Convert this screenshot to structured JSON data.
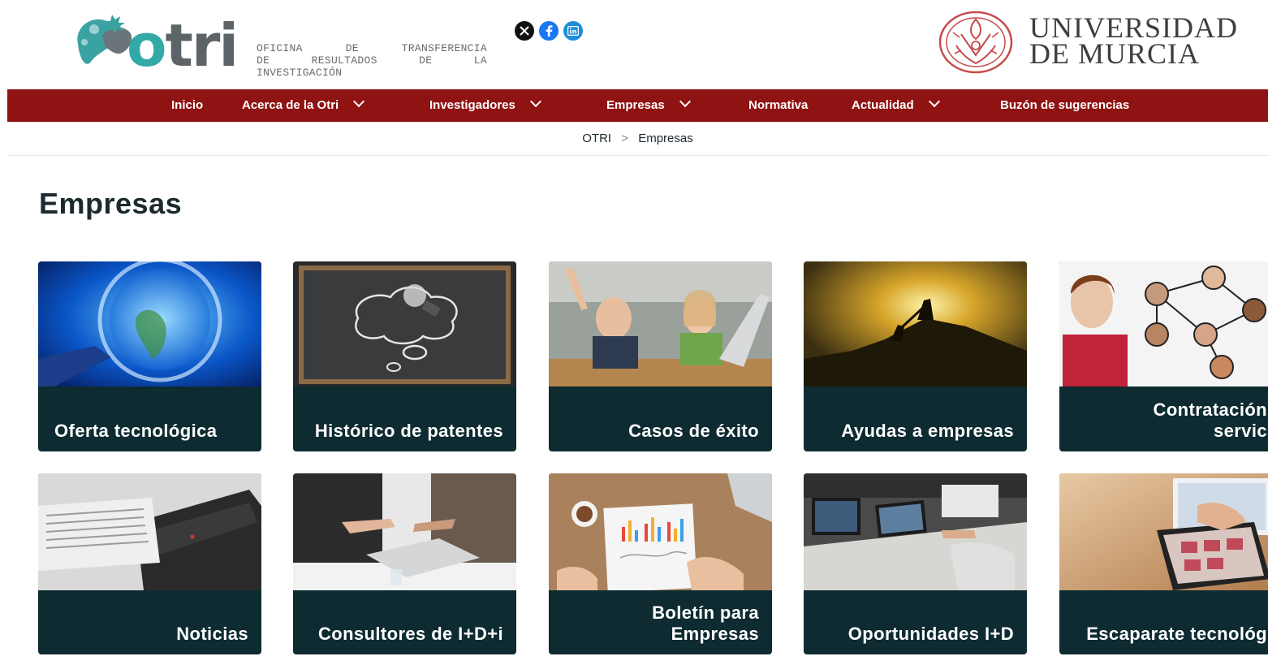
{
  "header": {
    "logo": {
      "word_o": "o",
      "word_rest": "tri",
      "sub_line1": [
        "OFICINA",
        "DE",
        "TRANSFERENCIA"
      ],
      "sub_line2": [
        "DE",
        "RESULTADOS",
        "DE",
        "LA"
      ],
      "sub_line3": "INVESTIGACIÓN"
    },
    "social": {
      "x_icon": "x-icon",
      "facebook_icon": "facebook-icon",
      "linkedin_icon": "linkedin-icon"
    },
    "university": {
      "line1": "UNIVERSIDAD",
      "line2": "DE MURCIA"
    }
  },
  "nav": {
    "items": [
      {
        "label": "Inicio",
        "has_dropdown": false
      },
      {
        "label": "Acerca de la Otri",
        "has_dropdown": true
      },
      {
        "label": "Investigadores",
        "has_dropdown": true
      },
      {
        "label": "Empresas",
        "has_dropdown": true
      },
      {
        "label": "Normativa",
        "has_dropdown": false
      },
      {
        "label": "Actualidad",
        "has_dropdown": true
      },
      {
        "label": "Buzón de sugerencias",
        "has_dropdown": false
      }
    ]
  },
  "breadcrumb": {
    "root": "OTRI",
    "separator": ">",
    "current": "Empresas"
  },
  "page": {
    "title": "Empresas"
  },
  "cards": [
    {
      "label": "Oferta tecnológica",
      "image": "globe-magnifier-photo"
    },
    {
      "label": "Histórico de patentes",
      "image": "lightbulb-chalkboard-photo"
    },
    {
      "label": "Casos de éxito",
      "image": "children-celebrating-photo"
    },
    {
      "label": "Ayudas a empresas",
      "image": "climbers-sunset-photo"
    },
    {
      "label": "Contratación de servicios",
      "image": "network-people-photo"
    },
    {
      "label": "Noticias",
      "image": "newspaper-laptop-photo"
    },
    {
      "label": "Consultores de I+D+i",
      "image": "business-meeting-photo"
    },
    {
      "label": "Boletín para Empresas",
      "image": "chart-paper-desk-photo"
    },
    {
      "label": "Oportunidades I+D",
      "image": "office-laptops-photo"
    },
    {
      "label": "Escaparate tecnológico",
      "image": "tablet-shopping-photo"
    }
  ],
  "colors": {
    "nav_bg": "#8f1312",
    "card_bg": "#0d2b30",
    "brand_teal": "#32a9a6"
  }
}
